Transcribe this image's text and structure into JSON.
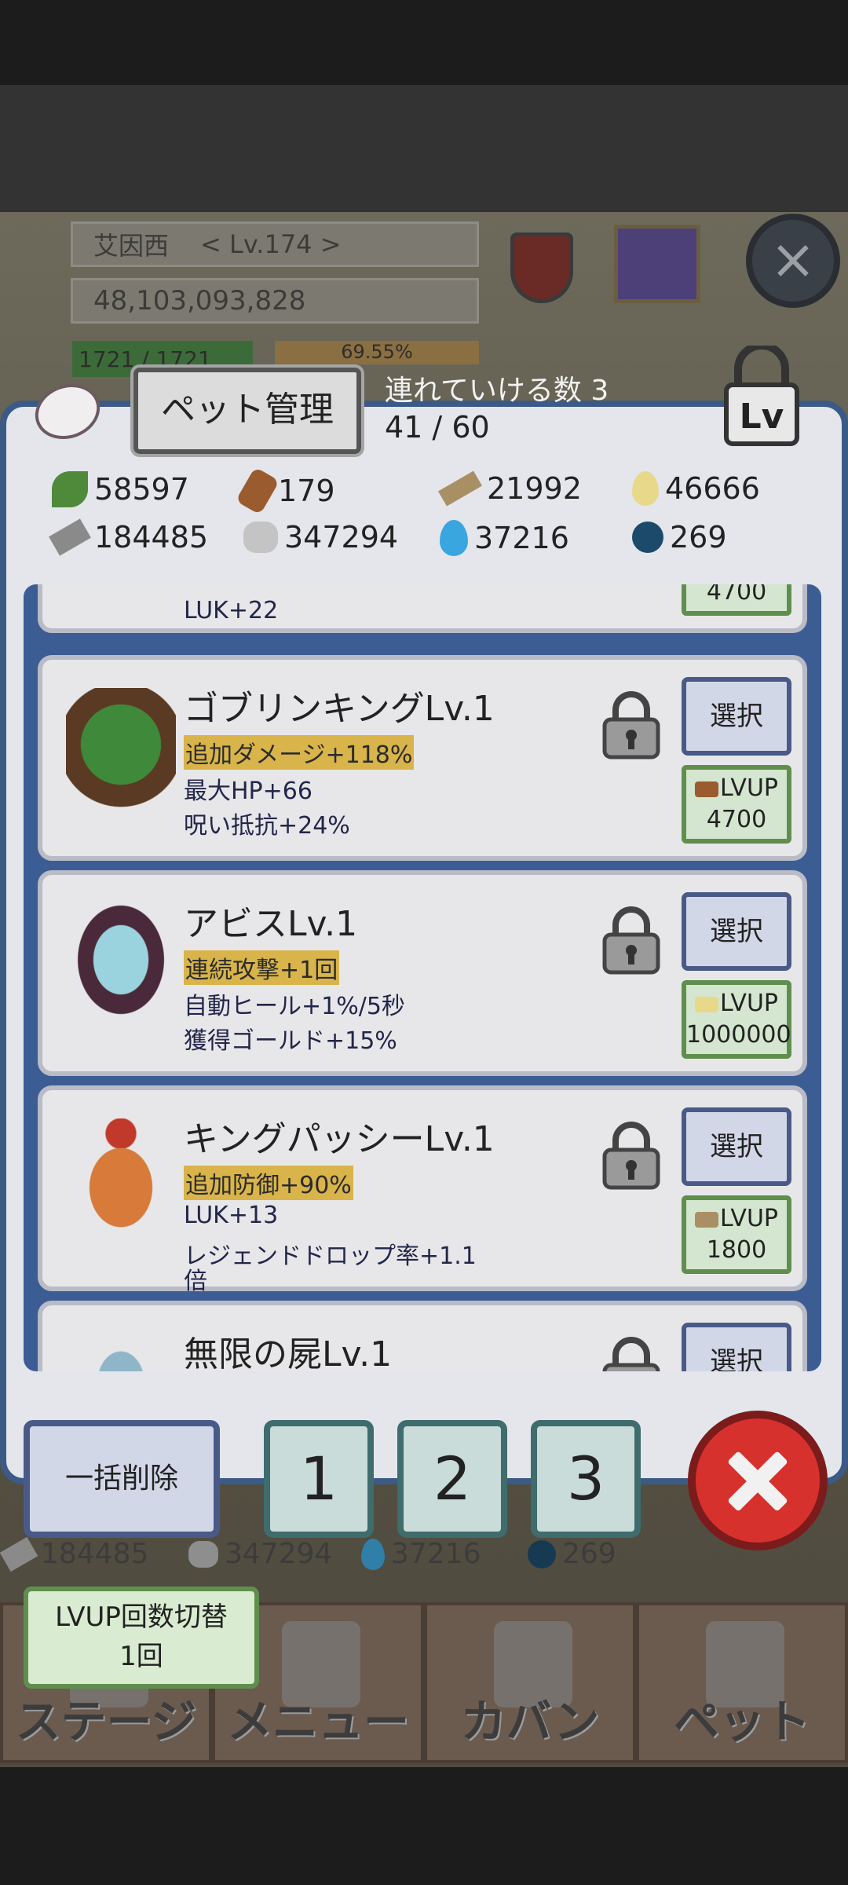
{
  "hud": {
    "player_name": "艾因西",
    "player_level": "< Lv.174 >",
    "gold": "48,103,093,828",
    "hp": "1721 / 1721",
    "exp_percent": "69.55%"
  },
  "modal": {
    "title": "ペット管理",
    "bring_label": "連れていける数 3",
    "count": "41 / 60",
    "lock_lv_label": "Lv",
    "resources": [
      {
        "icon": "leaf-icon",
        "value": "58597"
      },
      {
        "icon": "log-icon",
        "value": "179"
      },
      {
        "icon": "wood-plank-icon",
        "value": "21992"
      },
      {
        "icon": "drop-icon",
        "value": "46666"
      },
      {
        "icon": "iron-bar-icon",
        "value": "184485"
      },
      {
        "icon": "stone-icon",
        "value": "347294"
      },
      {
        "icon": "blue-flame-icon",
        "value": "37216"
      },
      {
        "icon": "dark-orb-icon",
        "value": "269"
      }
    ],
    "pets": [
      {
        "name": "",
        "lines": [
          "LUK+22"
        ],
        "highlight_first": false,
        "select_label": "",
        "lvup_label": "",
        "lvup_cost": "4700"
      },
      {
        "name": "ゴブリンキングLv.1",
        "lines": [
          "追加ダメージ+118%",
          "最大HP+66",
          "呪い抵抗+24%"
        ],
        "highlight_first": true,
        "select_label": "選択",
        "lvup_label": "LVUP",
        "lvup_cost": "4700"
      },
      {
        "name": "アビスLv.1",
        "lines": [
          "連続攻撃+1回",
          "自動ヒール+1%/5秒",
          "獲得ゴールド+15%"
        ],
        "highlight_first": true,
        "select_label": "選択",
        "lvup_label": "LVUP",
        "lvup_cost": "1000000"
      },
      {
        "name": "キングパッシーLv.1",
        "lines": [
          "追加防御+90%",
          "LUK+13",
          "レジェンドドロップ率+1.1",
          "倍"
        ],
        "highlight_first": true,
        "select_label": "選択",
        "lvup_label": "LVUP",
        "lvup_cost": "1800"
      },
      {
        "name": "無限の屍Lv.1",
        "lines": [],
        "highlight_first": false,
        "select_label": "選択",
        "lvup_label": "",
        "lvup_cost": ""
      }
    ],
    "bulk_delete": "一括削除",
    "slots": [
      "1",
      "2",
      "3"
    ]
  },
  "background_resources": [
    {
      "icon": "iron-bar-icon",
      "value": "184485"
    },
    {
      "icon": "stone-icon",
      "value": "347294"
    },
    {
      "icon": "blue-flame-icon",
      "value": "37216"
    },
    {
      "icon": "dark-orb-icon",
      "value": "269"
    }
  ],
  "lvup_toggle": {
    "line1": "LVUP回数切替",
    "line2": "1回"
  },
  "bottom_nav": [
    "ステージ",
    "メニュー",
    "カバン",
    "ペット"
  ],
  "colors": {
    "modal_border": "#3c5a86",
    "list_bg": "#3c5d94",
    "highlight": "#d8b44a",
    "close_red": "#d7312e"
  }
}
